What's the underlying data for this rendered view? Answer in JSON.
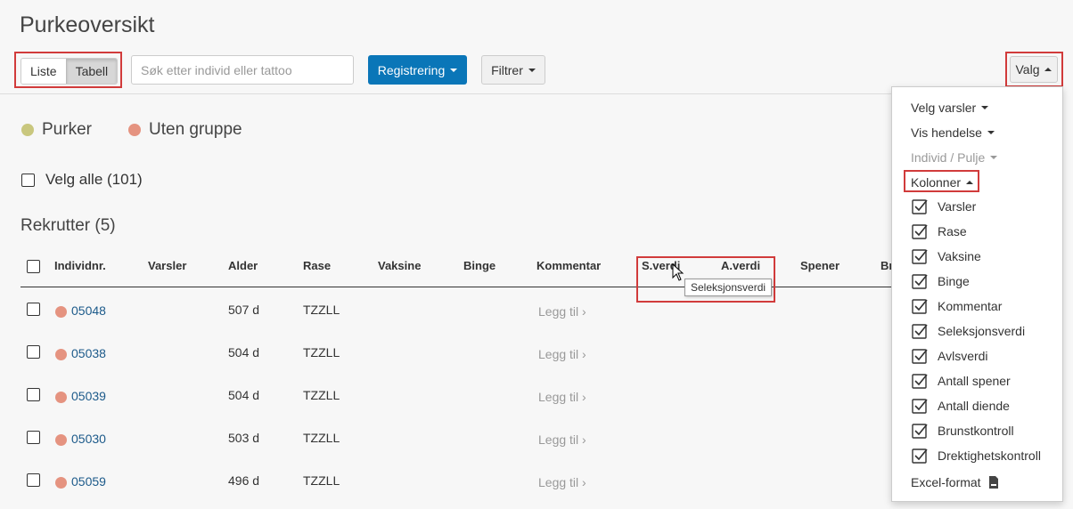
{
  "page": {
    "title": "Purkeoversikt"
  },
  "toolbar": {
    "view_list": "Liste",
    "view_table": "Tabell",
    "search_placeholder": "Søk etter individ eller tattoo",
    "register_label": "Registrering",
    "filter_label": "Filtrer",
    "options_label": "Valg"
  },
  "legend": [
    {
      "label": "Purker",
      "color": "#c9c77e"
    },
    {
      "label": "Uten gruppe",
      "color": "#e59380"
    }
  ],
  "select_all": "Velg alle (101)",
  "section": {
    "title": "Rekrutter (5)"
  },
  "table": {
    "columns": [
      "Individnr.",
      "Varsler",
      "Alder",
      "Rase",
      "Vaksine",
      "Binge",
      "Kommentar",
      "S.verdi",
      "A.verdi",
      "Spener",
      "Br"
    ],
    "rows": [
      {
        "id": "05048",
        "age": "507 d",
        "breed": "TZZLL",
        "comment": "Legg til ›"
      },
      {
        "id": "05038",
        "age": "504 d",
        "breed": "TZZLL",
        "comment": "Legg til ›"
      },
      {
        "id": "05039",
        "age": "504 d",
        "breed": "TZZLL",
        "comment": "Legg til ›"
      },
      {
        "id": "05030",
        "age": "503 d",
        "breed": "TZZLL",
        "comment": "Legg til ›"
      },
      {
        "id": "05059",
        "age": "496 d",
        "breed": "TZZLL",
        "comment": "Legg til ›"
      }
    ],
    "row_dot_color": "#e59380",
    "tooltip": "Seleksjonsverdi"
  },
  "dropdown": {
    "menus": [
      "Velg varsler",
      "Vis hendelse",
      "Individ / Pulje",
      "Kolonner"
    ],
    "columns": [
      "Varsler",
      "Rase",
      "Vaksine",
      "Binge",
      "Kommentar",
      "Seleksjonsverdi",
      "Avlsverdi",
      "Antall spener",
      "Antall diende",
      "Brunstkontroll",
      "Drektighetskontroll"
    ],
    "excel": "Excel-format"
  },
  "colors": {
    "primary": "#0a76b8",
    "highlight": "#d13b3b",
    "link": "#1c5a8a"
  }
}
